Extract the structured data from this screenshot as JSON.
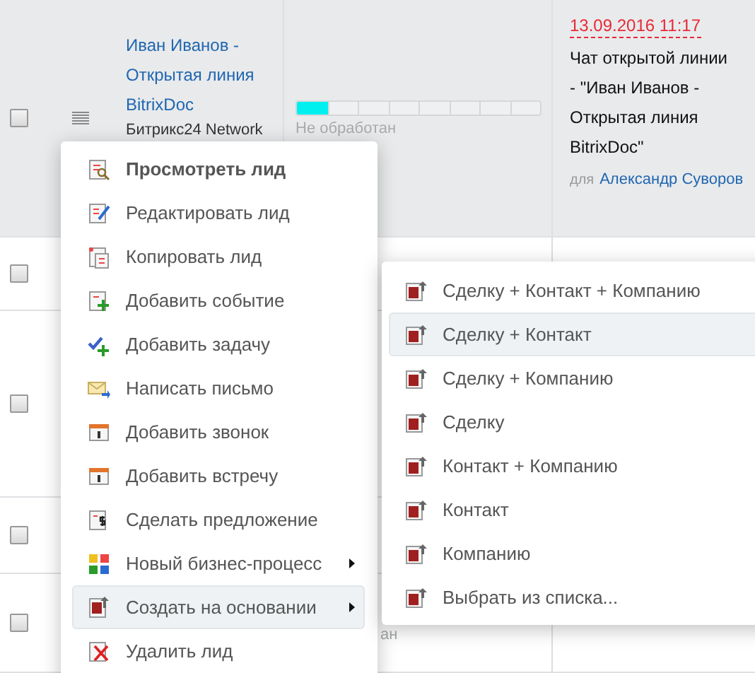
{
  "table": {
    "rows": [
      {
        "checked": false,
        "title": "Иван Иванов - Открытая линия BitrixDoc",
        "source": "Битрикс24 Network",
        "status": {
          "level": 0.125,
          "label": "Не обработан"
        },
        "activity": {
          "date": "13.09.2016 11:17",
          "text": "Чат открытой линии - \"Иван Иванов - Открытая линия BitrixDoc\"",
          "for_label": "для",
          "person": "Александр Суворов"
        }
      },
      {
        "checked": false
      },
      {
        "checked": false
      },
      {
        "checked": false
      },
      {
        "checked": false,
        "status_tail": "ан"
      }
    ]
  },
  "context_menu": {
    "items": [
      {
        "label": "Просмотреть лид",
        "bold": true,
        "selected": false,
        "submenu": false
      },
      {
        "label": "Редактировать лид",
        "bold": false,
        "selected": false,
        "submenu": false
      },
      {
        "label": "Копировать лид",
        "bold": false,
        "selected": false,
        "submenu": false
      },
      {
        "label": "Добавить событие",
        "bold": false,
        "selected": false,
        "submenu": false
      },
      {
        "label": "Добавить задачу",
        "bold": false,
        "selected": false,
        "submenu": false
      },
      {
        "label": "Написать письмо",
        "bold": false,
        "selected": false,
        "submenu": false
      },
      {
        "label": "Добавить звонок",
        "bold": false,
        "selected": false,
        "submenu": false
      },
      {
        "label": "Добавить встречу",
        "bold": false,
        "selected": false,
        "submenu": false
      },
      {
        "label": "Сделать предложение",
        "bold": false,
        "selected": false,
        "submenu": false
      },
      {
        "label": "Новый бизнес-процесс",
        "bold": false,
        "selected": false,
        "submenu": true
      },
      {
        "label": "Создать на основании",
        "bold": false,
        "selected": true,
        "submenu": true
      },
      {
        "label": "Удалить лид",
        "bold": false,
        "selected": false,
        "submenu": false
      }
    ]
  },
  "submenu": {
    "items": [
      {
        "label": "Сделку + Контакт + Компанию",
        "selected": false
      },
      {
        "label": "Сделку + Контакт",
        "selected": true
      },
      {
        "label": "Сделку + Компанию",
        "selected": false
      },
      {
        "label": "Сделку",
        "selected": false
      },
      {
        "label": "Контакт + Компанию",
        "selected": false
      },
      {
        "label": "Контакт",
        "selected": false
      },
      {
        "label": "Компанию",
        "selected": false
      },
      {
        "label": "Выбрать из списка...",
        "selected": false
      }
    ]
  }
}
